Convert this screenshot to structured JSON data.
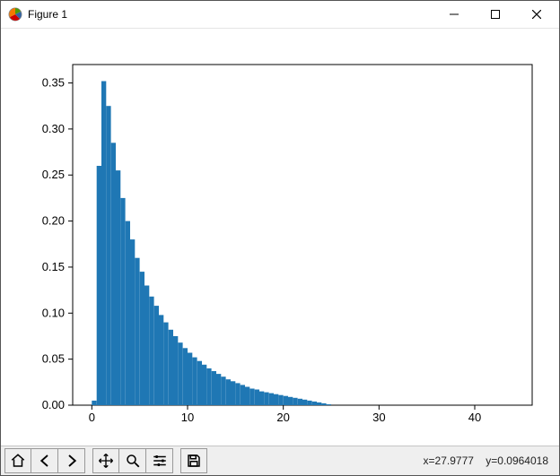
{
  "window": {
    "title": "Figure 1",
    "controls": {
      "minimize": "Minimize",
      "maximize": "Maximize",
      "close": "Close"
    }
  },
  "toolbar": {
    "home": "Home",
    "back": "Back",
    "forward": "Forward",
    "pan": "Pan",
    "zoom": "Zoom",
    "configure": "Configure subplots",
    "save": "Save figure"
  },
  "status": {
    "coords": "x=27.9777    y=0.0964018"
  },
  "chart_data": {
    "type": "bar",
    "title": "",
    "xlabel": "",
    "ylabel": "",
    "xlim": [
      -2,
      46
    ],
    "ylim": [
      0,
      0.37
    ],
    "xticks": [
      0,
      10,
      20,
      30,
      40
    ],
    "yticks": [
      0.0,
      0.05,
      0.1,
      0.15,
      0.2,
      0.25,
      0.3,
      0.35
    ],
    "bin_width": 0.5,
    "categories": [
      0.0,
      0.5,
      1.0,
      1.5,
      2.0,
      2.5,
      3.0,
      3.5,
      4.0,
      4.5,
      5.0,
      5.5,
      6.0,
      6.5,
      7.0,
      7.5,
      8.0,
      8.5,
      9.0,
      9.5,
      10.0,
      10.5,
      11.0,
      11.5,
      12.0,
      12.5,
      13.0,
      13.5,
      14.0,
      14.5,
      15.0,
      15.5,
      16.0,
      16.5,
      17.0,
      17.5,
      18.0,
      18.5,
      19.0,
      19.5,
      20.0,
      20.5,
      21.0,
      21.5,
      22.0,
      22.5,
      23.0,
      23.5,
      24.0,
      24.5,
      25.0
    ],
    "values": [
      0.005,
      0.26,
      0.352,
      0.325,
      0.285,
      0.255,
      0.225,
      0.2,
      0.18,
      0.16,
      0.145,
      0.13,
      0.118,
      0.108,
      0.098,
      0.09,
      0.082,
      0.075,
      0.068,
      0.062,
      0.057,
      0.052,
      0.048,
      0.044,
      0.04,
      0.037,
      0.034,
      0.031,
      0.028,
      0.026,
      0.024,
      0.022,
      0.02,
      0.018,
      0.017,
      0.015,
      0.014,
      0.013,
      0.012,
      0.011,
      0.01,
      0.009,
      0.008,
      0.007,
      0.006,
      0.005,
      0.004,
      0.003,
      0.002,
      0.001,
      0.0
    ],
    "bar_color": "#1f77b4"
  }
}
